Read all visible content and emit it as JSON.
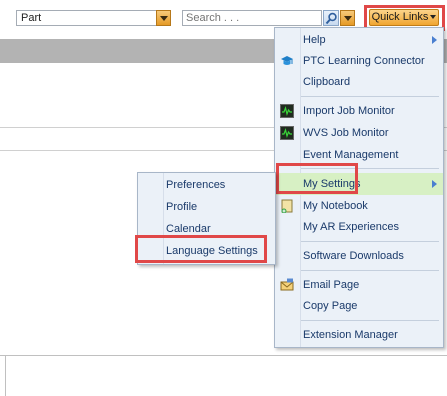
{
  "header": {
    "type_select": {
      "value": "Part"
    },
    "search": {
      "placeholder": "Search . . ."
    },
    "quick_links_label": "Quick Links"
  },
  "quick_links_menu": {
    "items": [
      {
        "label": "Help",
        "icon": "none",
        "has_submenu": true
      },
      {
        "label": "PTC Learning Connector",
        "icon": "graduation-cap-icon"
      },
      {
        "label": "Clipboard",
        "icon": "none"
      },
      {
        "label": "Import Job Monitor",
        "icon": "monitor-icon"
      },
      {
        "label": "WVS Job Monitor",
        "icon": "monitor-icon"
      },
      {
        "label": "Event Management",
        "icon": "none"
      },
      {
        "label": "My Settings",
        "icon": "none",
        "has_submenu": true,
        "active": true
      },
      {
        "label": "My Notebook",
        "icon": "notebook-icon"
      },
      {
        "label": "My AR Experiences",
        "icon": "none"
      },
      {
        "label": "Software Downloads",
        "icon": "none"
      },
      {
        "label": "Email Page",
        "icon": "email-icon"
      },
      {
        "label": "Copy Page",
        "icon": "none"
      },
      {
        "label": "Extension Manager",
        "icon": "none"
      }
    ]
  },
  "settings_submenu": {
    "items": [
      {
        "label": "Preferences"
      },
      {
        "label": "Profile"
      },
      {
        "label": "Calendar"
      },
      {
        "label": "Language Settings"
      }
    ]
  },
  "colors": {
    "highlight_box": "#e04848",
    "active_item": "#d7f0c4",
    "menu_background": "#ebf1f8",
    "button_orange": "#f0a531"
  }
}
